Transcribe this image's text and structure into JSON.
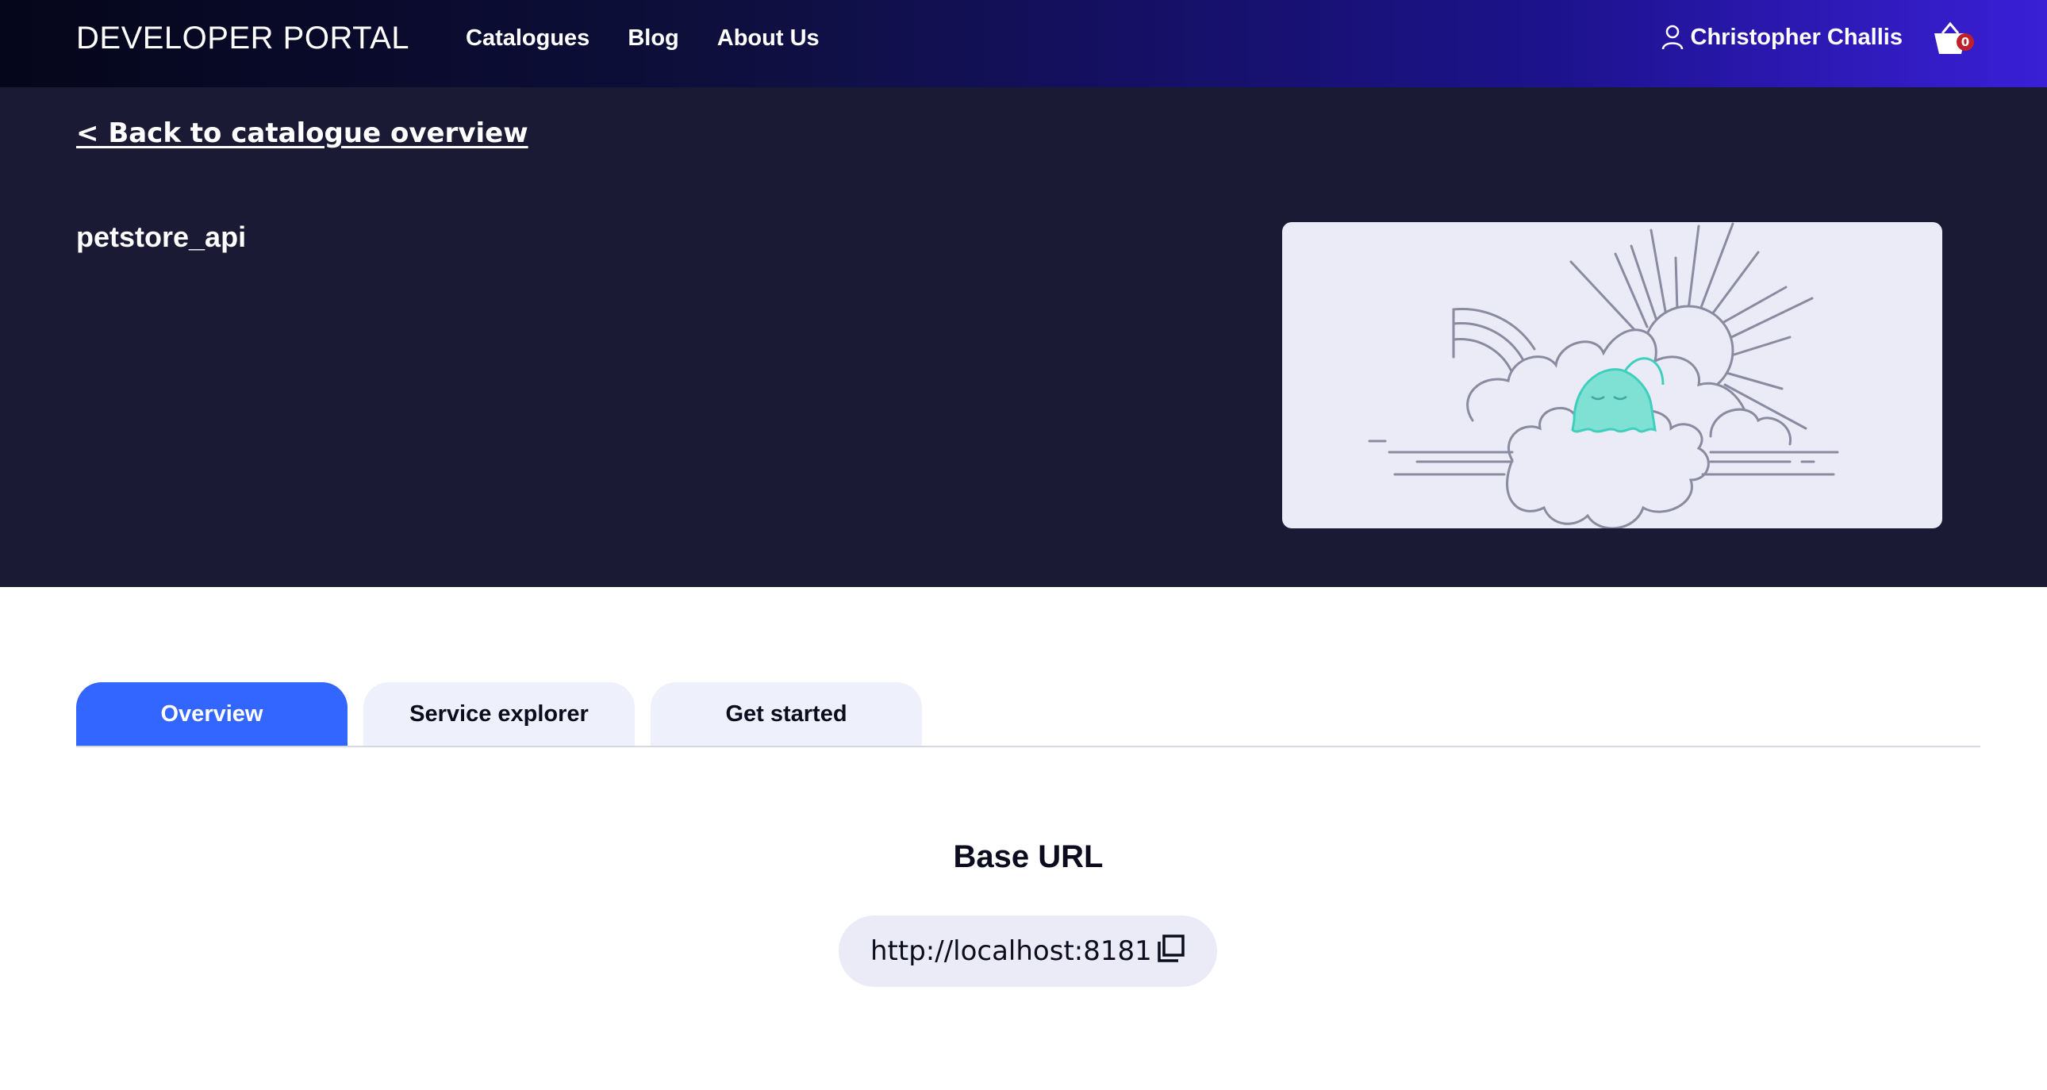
{
  "header": {
    "brand": "DEVELOPER PORTAL",
    "nav": [
      "Catalogues",
      "Blog",
      "About Us"
    ],
    "user_name": "Christopher Challis",
    "cart_count": "0",
    "icons": {
      "user": "user-icon",
      "cart": "basket-icon"
    }
  },
  "hero": {
    "back_link": "< Back to catalogue overview",
    "title": "petstore_api",
    "background": "#1a1a35"
  },
  "tabs": [
    {
      "label": "Overview",
      "active": true
    },
    {
      "label": "Service explorer",
      "active": false
    },
    {
      "label": "Get started",
      "active": false
    }
  ],
  "base_url": {
    "title": "Base URL",
    "value": "http://localhost:8181",
    "copy_icon": "copy-icon"
  },
  "colors": {
    "accent": "#3366ff",
    "tab_inactive": "#eef1fb",
    "pill": "#ebebf7"
  }
}
